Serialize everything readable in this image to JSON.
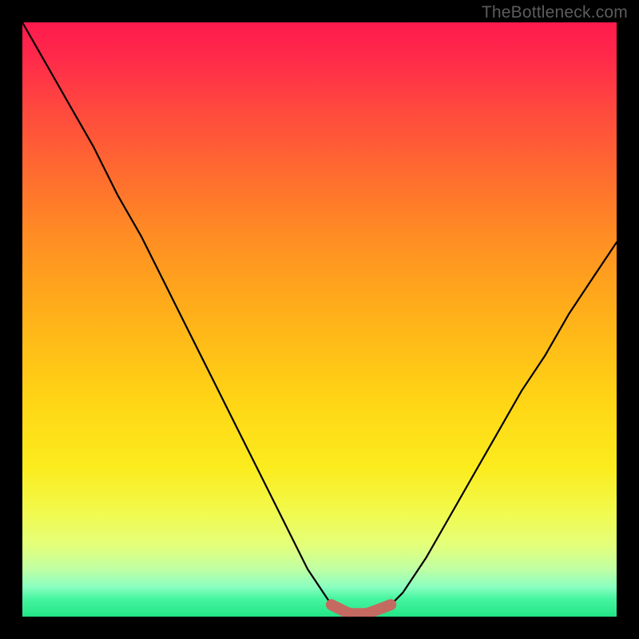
{
  "watermark": "TheBottleneck.com",
  "colors": {
    "frame": "#000000",
    "curve": "#000000",
    "accent_segment": "#c46a60",
    "gradient_top": "#ff1a4d",
    "gradient_bottom": "#22e287"
  },
  "chart_data": {
    "type": "line",
    "title": "",
    "xlabel": "",
    "ylabel": "",
    "xlim": [
      0,
      100
    ],
    "ylim": [
      0,
      100
    ],
    "grid": false,
    "legend": false,
    "description": "Bottleneck-style V curve over a red-to-green vertical gradient. Lower y (near 0) means better / optimal; the flat valley marks the balanced range.",
    "series": [
      {
        "name": "bottleneck-curve",
        "x": [
          0,
          4,
          8,
          12,
          16,
          20,
          24,
          28,
          32,
          36,
          40,
          44,
          48,
          52,
          55,
          58,
          62,
          64,
          68,
          72,
          76,
          80,
          84,
          88,
          92,
          96,
          100
        ],
        "y": [
          100,
          93,
          86,
          79,
          71,
          64,
          56,
          48,
          40,
          32,
          24,
          16,
          8,
          2,
          0.5,
          0.5,
          2,
          4,
          10,
          17,
          24,
          31,
          38,
          44,
          51,
          57,
          63
        ]
      }
    ],
    "highlight_range_x": [
      52,
      62
    ],
    "notes": "highlight_range_x is drawn as the thick salmon segment along the valley floor"
  }
}
